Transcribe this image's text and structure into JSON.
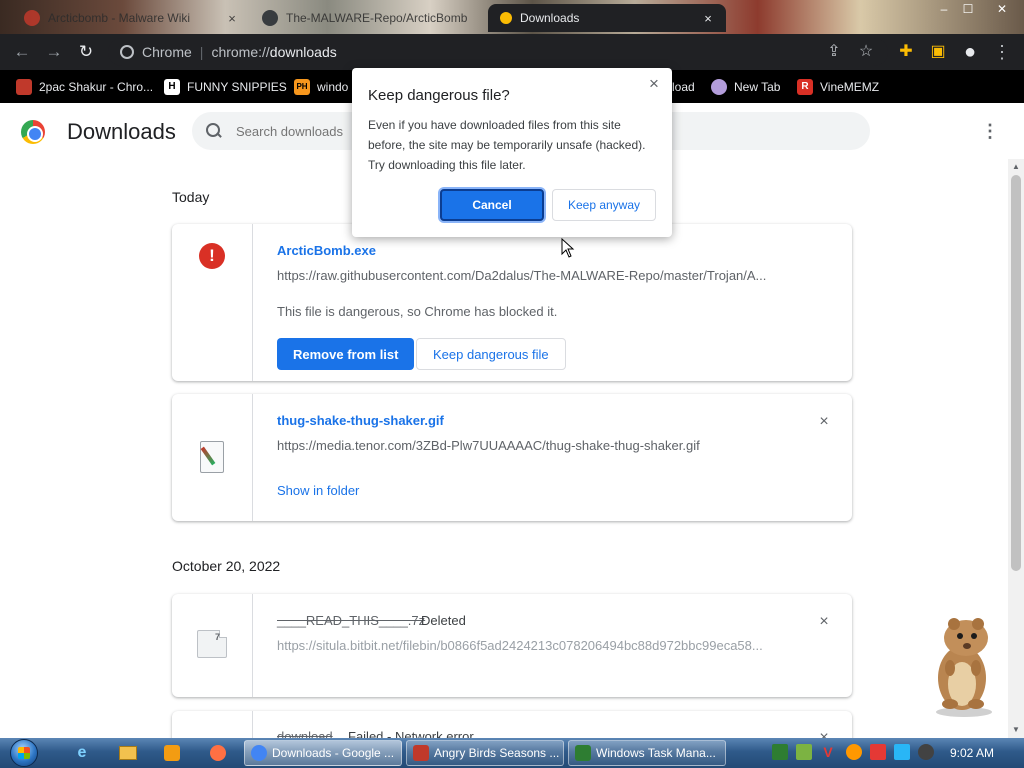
{
  "tabs": [
    {
      "label": "Arcticbomb - Malware Wiki",
      "close": "×"
    },
    {
      "label": "The-MALWARE-Repo/ArcticBomb",
      "close": "×"
    },
    {
      "label": "Downloads",
      "close": "×"
    }
  ],
  "window_controls": {
    "minimize": "–",
    "maximize": "☐",
    "close": "✕"
  },
  "toolbar": {
    "back": "←",
    "forward": "→",
    "reload": "↻",
    "site_label": "Chrome",
    "url_scheme": "chrome://",
    "url_path": "downloads",
    "share": "⇪",
    "bookmark_star": "☆",
    "extensions": "✚",
    "sidepanel": "▣",
    "profile": "●",
    "menu": "⋮"
  },
  "bookmarks": [
    {
      "label": "2pac Shakur - Chro...",
      "icon_text": "",
      "color": "#c0392b"
    },
    {
      "label": "FUNNY SNIPPIES",
      "icon_text": "H",
      "color": "#ffffff"
    },
    {
      "label": "windo",
      "icon_text": "PH",
      "color": "#f7971d"
    },
    {
      "label": "load",
      "icon_text": "",
      "color": "#000000"
    },
    {
      "label": "New Tab",
      "icon_text": "",
      "color": "#b39ddb"
    },
    {
      "label": "VineMEMZ",
      "icon_text": "R",
      "color": "#d93025"
    }
  ],
  "downloads_page": {
    "title": "Downloads",
    "search_placeholder": "Search downloads",
    "menu": "⋮"
  },
  "sections": [
    {
      "date": "Today",
      "items": [
        {
          "filename": "ArcticBomb.exe",
          "url": "https://raw.githubusercontent.com/Da2dalus/The-MALWARE-Repo/master/Trojan/A...",
          "description": "This file is dangerous, so Chrome has blocked it.",
          "primary_action": "Remove from list",
          "secondary_action": "Keep dangerous file",
          "icon": "!"
        },
        {
          "filename": "thug-shake-thug-shaker.gif",
          "url": "https://media.tenor.com/3ZBd-Plw7UUAAAAC/thug-shake-thug-shaker.gif",
          "link": "Show in folder",
          "close": "×"
        }
      ]
    },
    {
      "date": "October 20, 2022",
      "items": [
        {
          "filename": "____READ_THIS____.7z",
          "status": "Deleted",
          "url": "https://situla.bitbit.net/filebin/b0866f5ad2424213c078206494bc88d972bbc99eca58...",
          "close": "×",
          "file_icon_text": "7"
        },
        {
          "filename": "download",
          "status": "Failed - Network error",
          "close": "×"
        }
      ]
    }
  ],
  "dialog": {
    "title": "Keep dangerous file?",
    "body": "Even if you have downloaded files from this site before, the site may be temporarily unsafe (hacked). Try downloading this file later.",
    "cancel_label": "Cancel",
    "keep_label": "Keep anyway",
    "close": "×"
  },
  "scrollbar": {
    "up": "▲",
    "down": "▼"
  },
  "taskbar": {
    "tasks": [
      {
        "label": "Downloads - Google ...",
        "active": true,
        "icon_color": "#4285f4"
      },
      {
        "label": "Angry Birds Seasons ...",
        "active": false,
        "icon_color": "#c0392b"
      },
      {
        "label": "Windows Task Mana...",
        "active": false,
        "icon_color": "#2e7d32"
      }
    ],
    "clock": "9:02 AM"
  },
  "colors": {
    "accent": "#1a73e8",
    "danger": "#d93025",
    "toolbar_bg": "#202124",
    "taskbar_bg": "#2f5a8a"
  }
}
